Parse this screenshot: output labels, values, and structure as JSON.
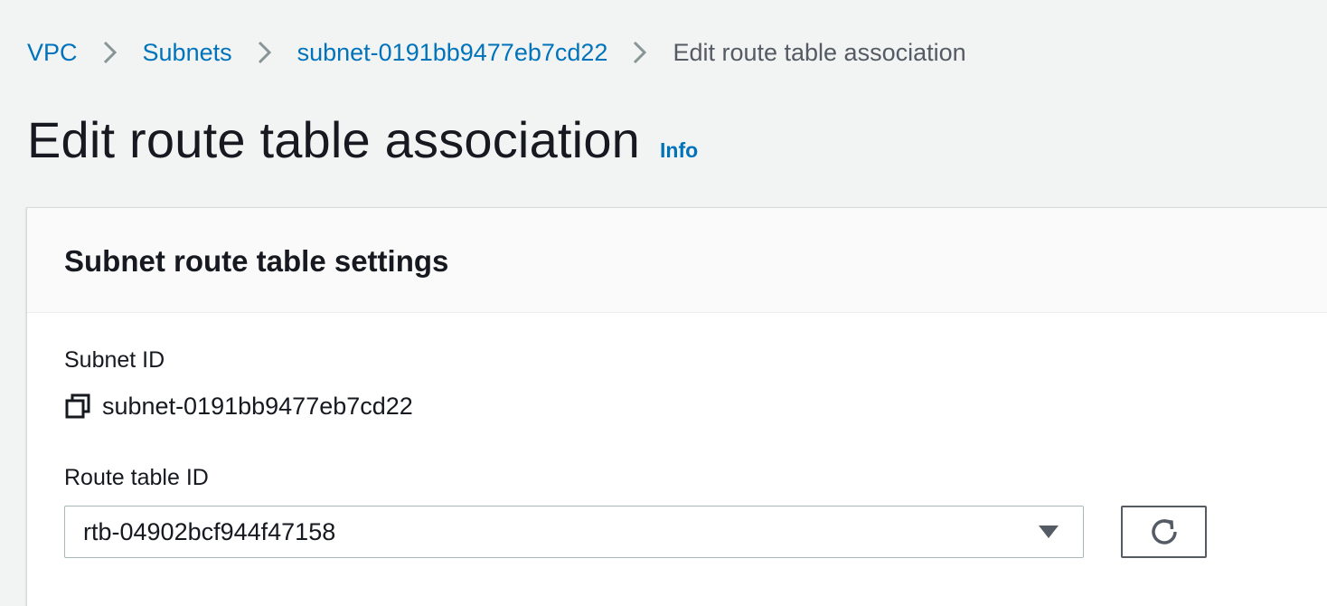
{
  "breadcrumb": {
    "items": [
      {
        "label": "VPC"
      },
      {
        "label": "Subnets"
      },
      {
        "label": "subnet-0191bb9477eb7cd22"
      }
    ],
    "current": "Edit route table association",
    "separator_icon": "chevron-right-icon"
  },
  "page": {
    "title": "Edit route table association",
    "info_label": "Info"
  },
  "panel": {
    "heading": "Subnet route table settings",
    "subnet_id": {
      "label": "Subnet ID",
      "value": "subnet-0191bb9477eb7cd22",
      "copy_icon": "copy-icon"
    },
    "route_table_id": {
      "label": "Route table ID",
      "selected_value": "rtb-04902bcf944f47158",
      "caret_icon": "caret-down-icon",
      "refresh_icon": "refresh-icon"
    }
  },
  "colors": {
    "link": "#0073bb",
    "text": "#16191f",
    "muted": "#545b64",
    "background": "#f2f3f3",
    "panel": "#ffffff",
    "panel_header": "#fafafa"
  }
}
